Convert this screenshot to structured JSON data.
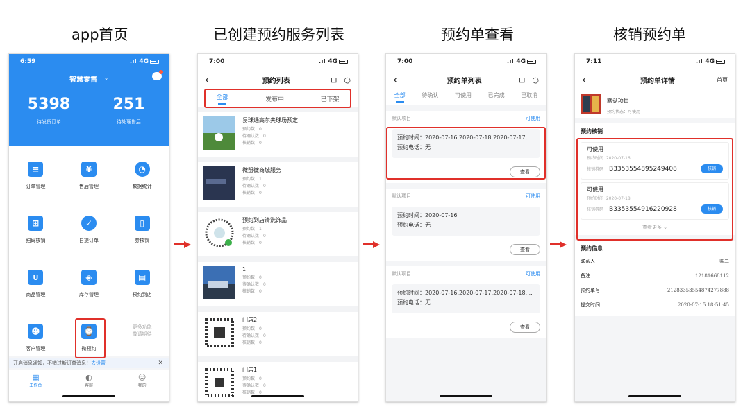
{
  "captions": [
    "app首页",
    "已创建预约服务列表",
    "预约单查看",
    "核销预约单"
  ],
  "p1": {
    "time": "6:59",
    "signal": "4G",
    "store": "智慧零售",
    "stats": [
      {
        "value": "5398",
        "label": "待发货订单"
      },
      {
        "value": "251",
        "label": "待处理售后"
      }
    ],
    "menu": [
      {
        "label": "订单管理",
        "icon": "order-icon"
      },
      {
        "label": "售后管理",
        "icon": "aftersale-icon"
      },
      {
        "label": "数据统计",
        "icon": "pie-chart-icon"
      },
      {
        "label": "扫码核销",
        "icon": "scan-icon"
      },
      {
        "label": "自提订单",
        "icon": "pickup-icon"
      },
      {
        "label": "券核销",
        "icon": "coupon-icon"
      },
      {
        "label": "商品管理",
        "icon": "goods-icon"
      },
      {
        "label": "库存管理",
        "icon": "stock-icon"
      },
      {
        "label": "预约到店",
        "icon": "calendar-icon"
      },
      {
        "label": "客户管理",
        "icon": "customer-icon"
      },
      {
        "label": "微预约",
        "icon": "booking-icon"
      }
    ],
    "more": "更多功能\n敬请期待\n...",
    "notice": "开启消息通知，不错过新订单消息！",
    "notice_link": "去设置",
    "tabs": [
      "工作台",
      "客服",
      "我的"
    ]
  },
  "p2": {
    "time": "7:00",
    "signal": "4G",
    "title": "预约列表",
    "tabs": [
      "全部",
      "发布中",
      "已下架"
    ],
    "services": [
      {
        "title": "易球通高尔夫球场预定",
        "count": "预约数：0",
        "pending": "待确认数：0",
        "verified": "核销数：0"
      },
      {
        "title": "微盟微商城服务",
        "count": "预约数：1",
        "pending": "待确认数：0",
        "verified": "核销数：0"
      },
      {
        "title": "预约到店清洗饰品",
        "count": "预约数：1",
        "pending": "待确认数：0",
        "verified": "核销数：0"
      },
      {
        "title": "1",
        "count": "预约数：0",
        "pending": "待确认数：0",
        "verified": "核销数：0"
      },
      {
        "title": "门店2",
        "count": "预约数：0",
        "pending": "待确认数：0",
        "verified": "核销数：0"
      },
      {
        "title": "门店1",
        "count": "预约数：0",
        "pending": "待确认数：0",
        "verified": "核销数：0"
      }
    ]
  },
  "p3": {
    "time": "7:00",
    "signal": "4G",
    "title": "预约单列表",
    "tabs": [
      "全部",
      "待确认",
      "可使用",
      "已完成",
      "已取消"
    ],
    "orders": [
      {
        "item": "默认项目",
        "status": "可使用",
        "time": "预约时间：2020-07-16,2020-07-18,2020-07-17,...",
        "phone": "预约电话：无",
        "btn": "查看"
      },
      {
        "item": "默认项目",
        "status": "可使用",
        "time": "预约时间：2020-07-16",
        "phone": "预约电话：无",
        "btn": "查看"
      },
      {
        "item": "默认项目",
        "status": "可使用",
        "time": "预约时间：2020-07-16,2020-07-17,2020-07-18,...",
        "phone": "预约电话：无",
        "btn": "查看"
      }
    ]
  },
  "p4": {
    "time": "7:11",
    "signal": "4G",
    "title": "预约单详情",
    "home": "首页",
    "item": "默认项目",
    "item_status": "预约状态：可使用",
    "verify_title": "预约核销",
    "vouchers": [
      {
        "status": "可使用",
        "date_label": "预约时间",
        "date": "2020-07-16",
        "code_label": "核销券码",
        "code": "B3353554895249408",
        "btn": "核销"
      },
      {
        "status": "可使用",
        "date_label": "预约时间",
        "date": "2020-07-18",
        "code_label": "核销券码",
        "code": "B3353554916220928",
        "btn": "核销"
      }
    ],
    "more": "查看更多 ⌄",
    "info_title": "预约信息",
    "info": [
      {
        "k": "联系人",
        "v": "柴二"
      },
      {
        "k": "备注",
        "v": "12181668112"
      },
      {
        "k": "预约单号",
        "v": "21283353554874277888"
      },
      {
        "k": "提交时间",
        "v": "2020-07-15 18:51:45"
      }
    ]
  },
  "colors": {
    "accent": "#2b8cf0",
    "highlight": "#e0302a"
  }
}
